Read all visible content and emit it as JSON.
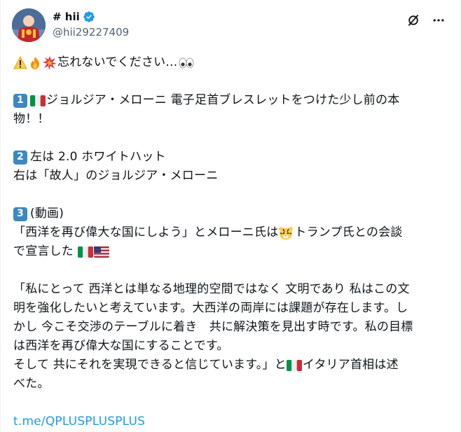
{
  "author": {
    "display_name": "# hii",
    "handle": "@hii29227409"
  },
  "post": {
    "line1": "忘れないでください…",
    "p1_num": "1",
    "p1_line1": "ジョルジア・メローニ 電子足首ブレスレットをつけた少し前の本",
    "p1_line2": "物！！",
    "p2_num": "2",
    "p2_line1": "左は 2.0 ホワイトハット",
    "p2_line2": "右は「故人」のジョルジア・メローニ",
    "p3_num": "3",
    "p3_line1": "(動画)",
    "p3_line2a": "「西洋を再び偉大な国にしよう」とメローニ氏は",
    "p3_line2b": "トランプ氏との会談",
    "p3_line3": "で宣言した",
    "q_line1": "「私にとって 西洋とは単なる地理的空間ではなく 文明であり 私はこの文",
    "q_line2": "明を強化したいと考えています。大西洋の両岸には課題が存在します。し",
    "q_line3": "かし 今こそ交渉のテーブルに着き　共に解決策を見出す時です。私の目標",
    "q_line4": "は西洋を再び偉大な国にすることです。",
    "q_line5a": "そして 共にそれを実現できると信じています。」と",
    "q_line5b": "イタリア首相は述",
    "q_line6": "べた。",
    "link": "t.me/QPLUSPLUSPLUS"
  },
  "icons": {
    "verified_color": "#1d9bf0",
    "link_color": "#1d9bf0"
  }
}
